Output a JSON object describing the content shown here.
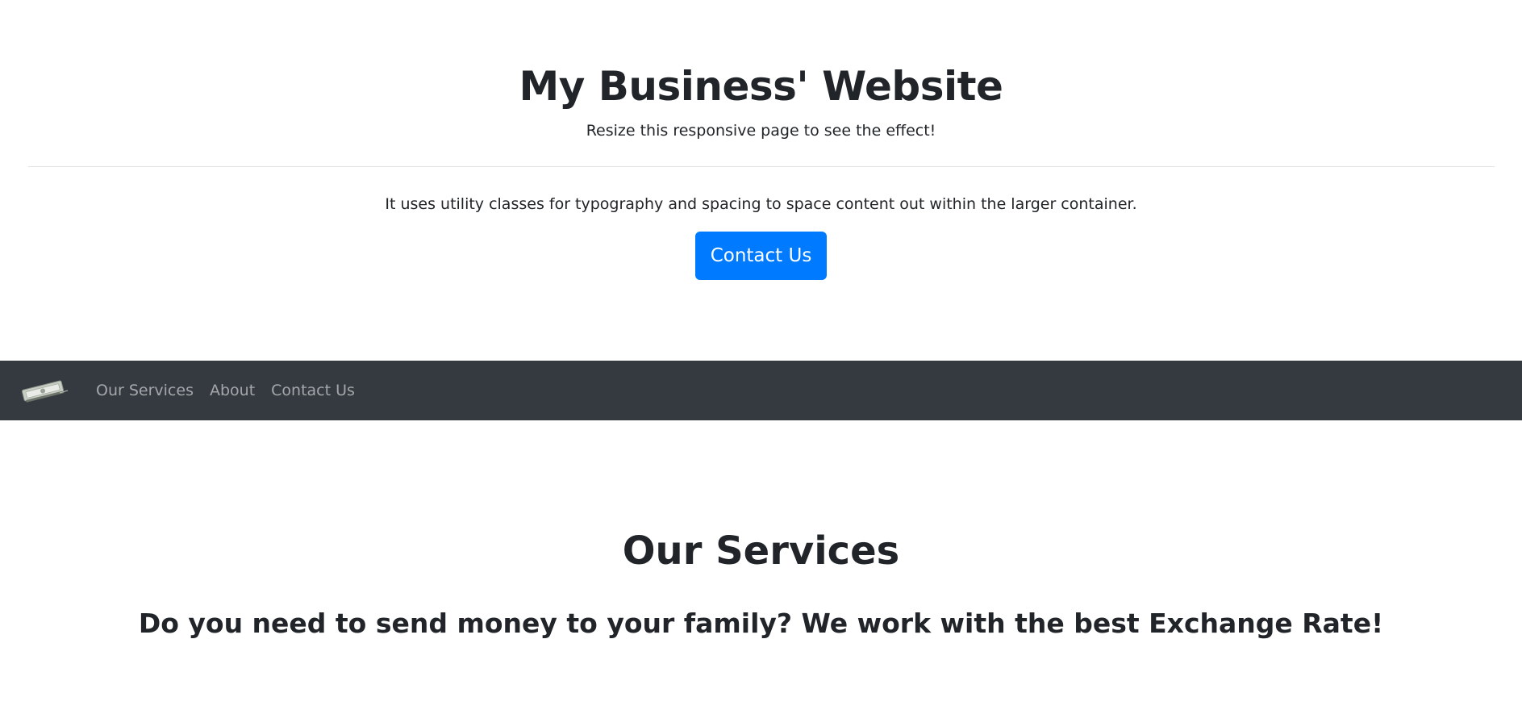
{
  "header": {
    "title": "My Business' Website",
    "subtitle": "Resize this responsive page to see the effect!",
    "description": "It uses utility classes for typography and spacing to space content out within the larger container.",
    "cta_label": "Contact Us",
    "cta_color": "#007bff"
  },
  "navbar": {
    "background": "#343a40",
    "logo_icon": "money-bill-icon",
    "links": [
      {
        "label": "Our Services"
      },
      {
        "label": "About"
      },
      {
        "label": "Contact Us"
      }
    ]
  },
  "services": {
    "title": "Our Services",
    "subtitle": "Do you need to send money to your family? We work with the best Exchange Rate!"
  }
}
